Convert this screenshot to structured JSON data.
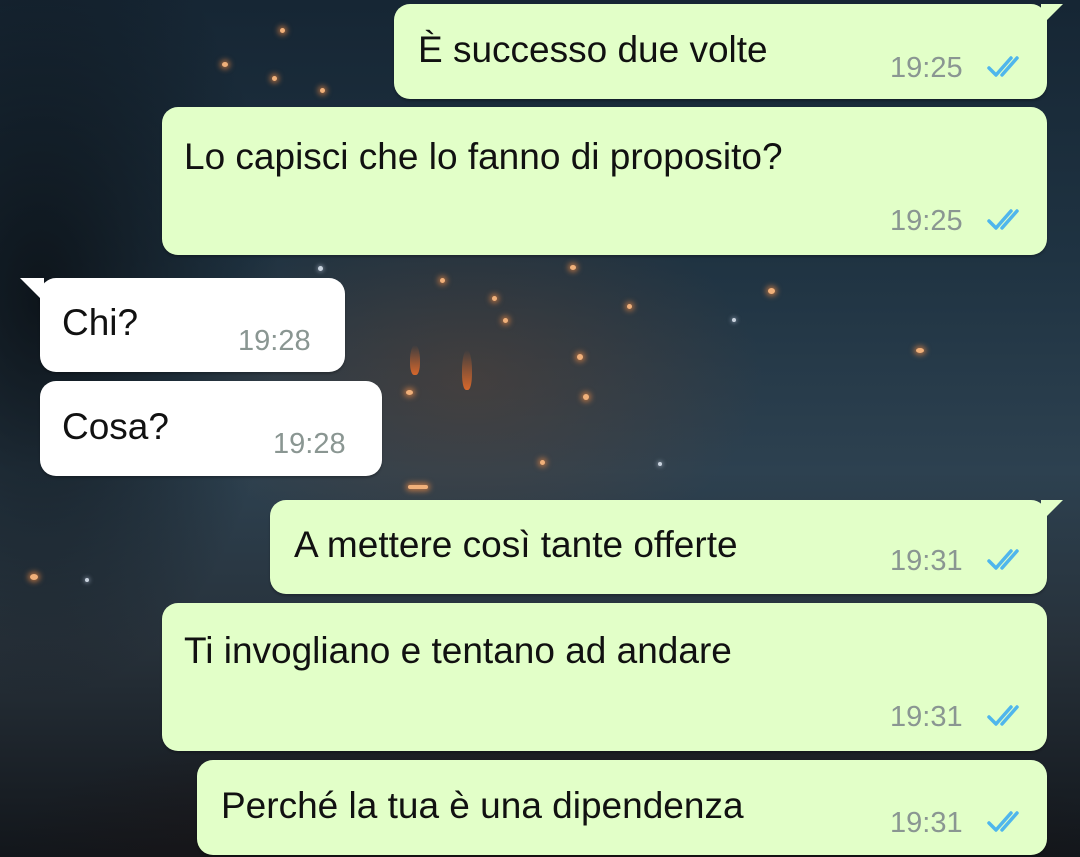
{
  "colors": {
    "outgoing_bubble": "#e2ffc8",
    "incoming_bubble": "#ffffff",
    "read_ticks": "#4fb6ec",
    "timestamp": "#8a9692"
  },
  "icons": {
    "read_status": "double-check-icon"
  },
  "messages": [
    {
      "direction": "outgoing",
      "text": "È successo due volte",
      "time": "19:25",
      "status": "read"
    },
    {
      "direction": "outgoing",
      "text": "Lo capisci che lo fanno di proposito?",
      "time": "19:25",
      "status": "read"
    },
    {
      "direction": "incoming",
      "text": "Chi?",
      "time": "19:28"
    },
    {
      "direction": "incoming",
      "text": "Cosa?",
      "time": "19:28"
    },
    {
      "direction": "outgoing",
      "text": "A mettere così tante offerte",
      "time": "19:31",
      "status": "read"
    },
    {
      "direction": "outgoing",
      "text": "Ti invogliano e tentano ad andare",
      "time": "19:31",
      "status": "read"
    },
    {
      "direction": "outgoing",
      "text": "Perché la tua è una dipendenza",
      "time": "19:31",
      "status": "read"
    }
  ]
}
